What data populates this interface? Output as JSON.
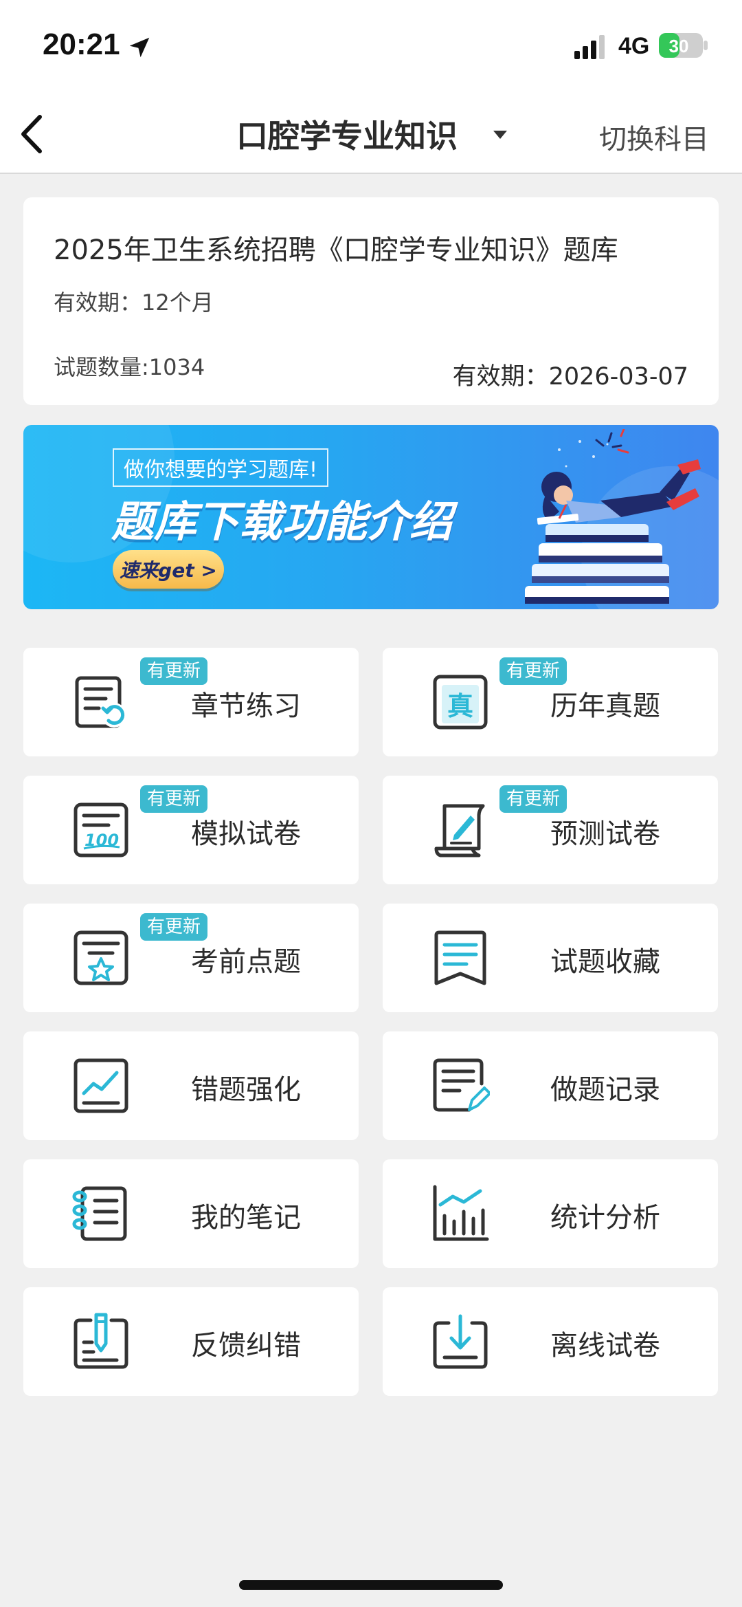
{
  "status_bar": {
    "time": "20:21",
    "network": "4G",
    "battery": "30",
    "battery_color": "#34c759"
  },
  "nav": {
    "title": "口腔学专业知识",
    "switch_label": "切换科目"
  },
  "info_card": {
    "title": "2025年卫生系统招聘《口腔学专业知识》题库",
    "validity": "有效期：12个月",
    "question_count": "试题数量:1034",
    "expire": "有效期：2026-03-07"
  },
  "banner": {
    "tagline": "做你想要的学习题库!",
    "headline": "题库下载功能介绍",
    "cta": "速来get >"
  },
  "tiles": [
    {
      "label": "章节练习",
      "badge": "有更新",
      "icon": "chapter-practice-icon"
    },
    {
      "label": "历年真题",
      "badge": "有更新",
      "icon": "past-exams-icon"
    },
    {
      "label": "模拟试卷",
      "badge": "有更新",
      "icon": "mock-paper-icon"
    },
    {
      "label": "预测试卷",
      "badge": "有更新",
      "icon": "forecast-paper-icon"
    },
    {
      "label": "考前点题",
      "badge": "有更新",
      "icon": "key-points-icon"
    },
    {
      "label": "试题收藏",
      "badge": "",
      "icon": "favorites-icon"
    },
    {
      "label": "错题强化",
      "badge": "",
      "icon": "wrong-questions-icon"
    },
    {
      "label": "做题记录",
      "badge": "",
      "icon": "practice-record-icon"
    },
    {
      "label": "我的笔记",
      "badge": "",
      "icon": "notes-icon"
    },
    {
      "label": "统计分析",
      "badge": "",
      "icon": "statistics-icon"
    },
    {
      "label": "反馈纠错",
      "badge": "",
      "icon": "feedback-icon"
    },
    {
      "label": "离线试卷",
      "badge": "",
      "icon": "offline-download-icon"
    }
  ],
  "colors": {
    "accent": "#3cb9cf",
    "icon_dark": "#333333",
    "icon_accent": "#2bb8d6"
  }
}
